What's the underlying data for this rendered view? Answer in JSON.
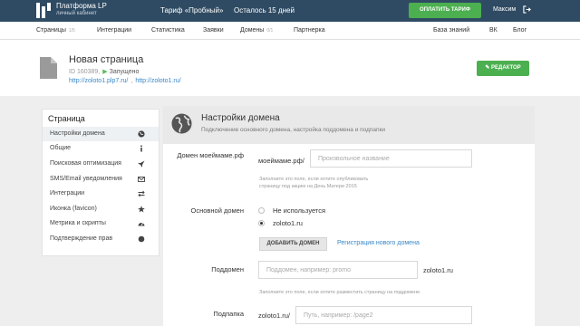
{
  "colors": {
    "topbar": "#2f4b63",
    "accent_green": "#4caf50",
    "link": "#3a87c8"
  },
  "header": {
    "brand_title": "Платформа LP",
    "brand_subtitle": "личный кабинет",
    "tariff": "Тариф «Пробный»",
    "remaining": "Осталось 15 дней",
    "pay_button": "ОПЛАТИТЬ ТАРИФ",
    "user_name": "Максим"
  },
  "nav": {
    "pages": "Страницы",
    "pages_count": "1/5",
    "integrations": "Интеграции",
    "statistics": "Статистика",
    "requests": "Заявки",
    "domains": "Домены",
    "domains_count": "0/1",
    "partnership": "Партнерка",
    "knowledge_base": "База знаний",
    "vk": "ВК",
    "blog": "Блог"
  },
  "page": {
    "title": "Новая страница",
    "id_label": "ID 160389,",
    "status": "Запущено",
    "link1": "http://zoloto1.plp7.ru/",
    "link_sep": ",",
    "link2": "http://zoloto1.ru/",
    "editor_button": "РЕДАКТОР"
  },
  "sidebar": {
    "title": "Страница",
    "items": [
      {
        "label": "Настройки домена",
        "icon": "globe-icon"
      },
      {
        "label": "Общие",
        "icon": "info-icon"
      },
      {
        "label": "Поисковая оптимизация",
        "icon": "rocket-icon"
      },
      {
        "label": "SMS/Email уведомления",
        "icon": "envelope-icon"
      },
      {
        "label": "Интеграции",
        "icon": "exchange-icon"
      },
      {
        "label": "Иконка (favicon)",
        "icon": "star-icon"
      },
      {
        "label": "Метрика и скрипты",
        "icon": "dashboard-icon"
      },
      {
        "label": "Подтверждение прав",
        "icon": "circle-icon"
      }
    ]
  },
  "domain_settings": {
    "title": "Настройки домена",
    "subtitle": "Подключение основного домена, настройка поддомена и подпапки",
    "domain_label": "Домен моеймаме.рф",
    "domain_prefix": "моеймаме.рф/",
    "domain_placeholder": "Произвольное название",
    "domain_hint": "Заполните это поле, если хотите опубликовать страницу под акцию на День Матери 2015",
    "main_domain_label": "Основной домен",
    "option_none": "Не используется",
    "option_domain": "zoloto1.ru",
    "add_domain_button": "ДОБАВИТЬ ДОМЕН",
    "register_link": "Регистрация нового домена",
    "subdomain_label": "Поддомен",
    "subdomain_placeholder": "Поддомен, например: promo",
    "subdomain_suffix": "zoloto1.ru",
    "subdomain_hint": "Заполните это поле, если хотите разместить страницу на поддомене.",
    "subfolder_label": "Подпапка",
    "subfolder_prefix": "zoloto1.ru/",
    "subfolder_placeholder": "Путь, например: /page2"
  }
}
